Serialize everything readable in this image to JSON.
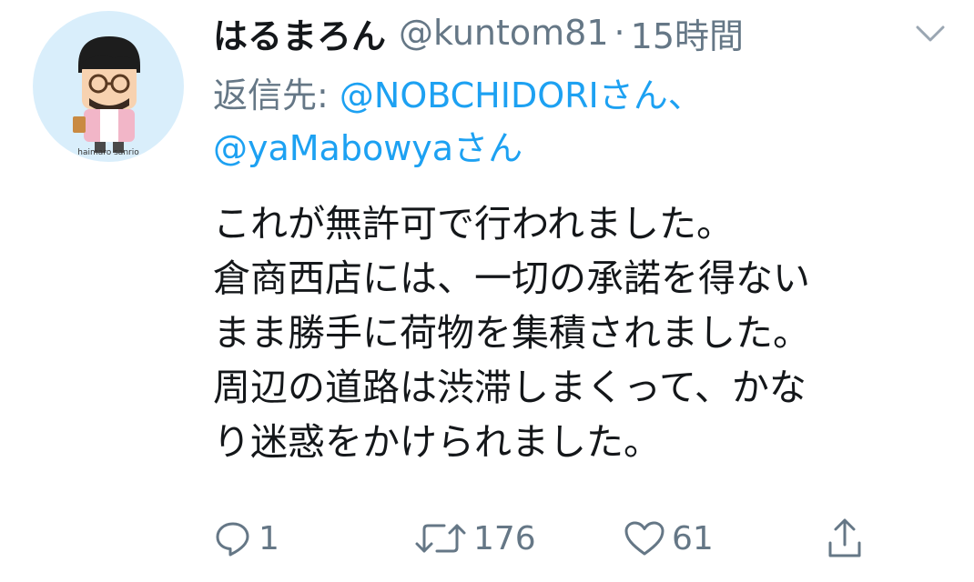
{
  "tweet": {
    "author": {
      "display_name": "はるまろん",
      "handle": "@kuntom81",
      "avatar_caption": "haimaro sanrio"
    },
    "separator": "·",
    "time": "15時間",
    "reply": {
      "prefix": "返信先: ",
      "mention_1": "@NOBCHIDORIさん、",
      "mention_2": "@yaMabowyaさん"
    },
    "text_lines": [
      "これが無許可で行われました。",
      "倉商西店には、一切の承諾を得ない",
      "まま勝手に荷物を集積されました。",
      "周辺の道路は渋滞しまくって、かな",
      "り迷惑をかけられました。"
    ],
    "actions": {
      "reply_count": "1",
      "retweet_count": "176",
      "like_count": "61"
    }
  },
  "colors": {
    "text": "#14171a",
    "secondary": "#657786",
    "link": "#1da1f2",
    "avatar_bg": "#d9eefb"
  },
  "icons": [
    "reply-icon",
    "retweet-icon",
    "like-icon",
    "share-icon",
    "chevron-down-icon"
  ]
}
